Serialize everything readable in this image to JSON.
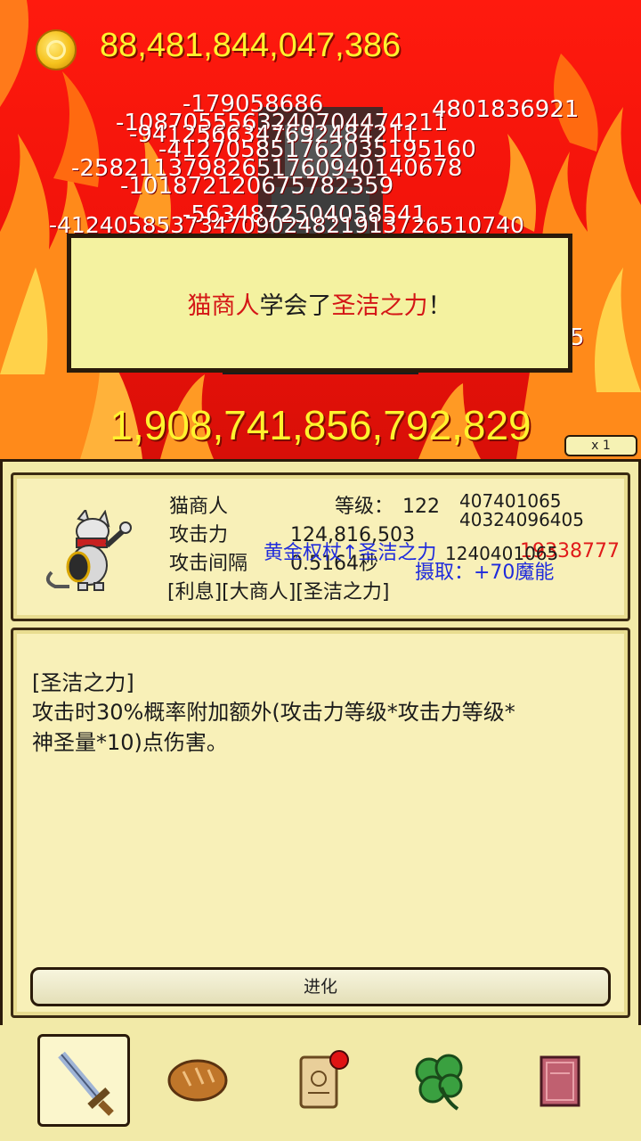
{
  "top": {
    "gold_amount": "88,481,844,047,386"
  },
  "damage_texts": [
    {
      "text": "-179058686"
    },
    {
      "text": "-1087055563240704474211"
    },
    {
      "text": "4801836921"
    },
    {
      "text": "-9412566347692484211"
    },
    {
      "text": "-412705851762035195160"
    },
    {
      "text": "-25821137982651760940140678"
    },
    {
      "text": "-101872120675782359"
    },
    {
      "text": "-5634872504058541"
    },
    {
      "text": "-412405853734709024821913726510740"
    },
    {
      "text": "5"
    }
  ],
  "message": {
    "part1": "猫商人",
    "part2": "学会了",
    "part3": "圣洁之力",
    "part4": "！"
  },
  "total_damage": "1,908,741,856,792,829",
  "speed_button": "x 1",
  "character": {
    "name": "猫商人",
    "level_label": "等级：",
    "level_value": "122",
    "atk_label": "攻击力",
    "atk_value": "124,816,503",
    "interval_label": "攻击间隔",
    "interval_value": "0.5164秒",
    "tags": "[利息][大商人][圣洁之力]",
    "float_black1": "407401065",
    "float_black2": "40324096405",
    "float_black3": "1240401065",
    "float_blue1": "黄金权杖↑圣洁之力",
    "float_blue2": "摄取：+70魔能",
    "float_red1": "19338777"
  },
  "skill": {
    "title": "[圣洁之力]",
    "desc_line1": "攻击时30%概率附加额外(攻击力等级*攻击力等级*",
    "desc_line2": "神圣量*10)点伤害。"
  },
  "evolve_label": "进化",
  "tabs": [
    {
      "icon": "sword-icon",
      "active": true
    },
    {
      "icon": "bread-icon",
      "active": false
    },
    {
      "icon": "scroll-icon",
      "active": false,
      "badge": true
    },
    {
      "icon": "clover-icon",
      "active": false
    },
    {
      "icon": "book-icon",
      "active": false
    }
  ],
  "colors": {
    "gold_text": "#fff32e",
    "panel_bg": "#f2eaa8",
    "highlight_red": "#d41616",
    "float_blue": "#1f2bdc"
  }
}
